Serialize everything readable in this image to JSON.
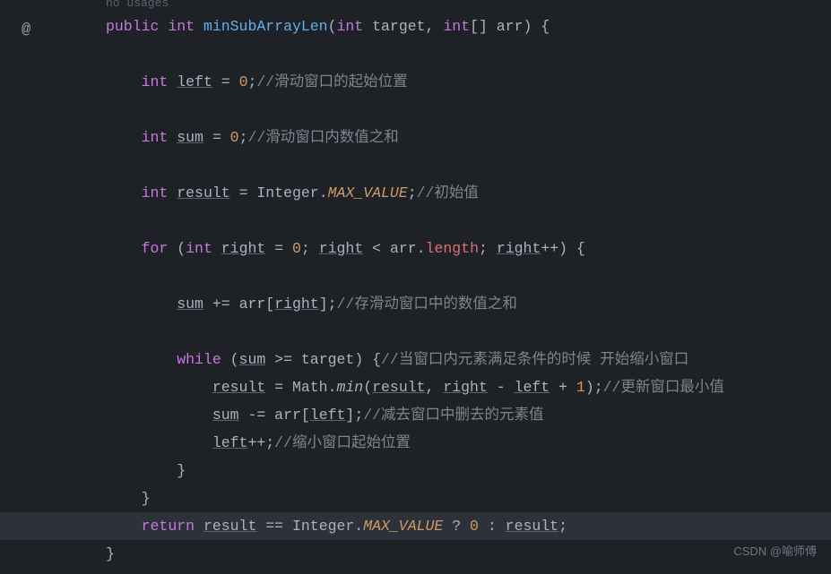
{
  "gutter": {
    "icon_glyph": "@"
  },
  "usages_hint": "no usages",
  "code": {
    "l1": {
      "public": "public",
      "int": "int",
      "method": "minSubArrayLen",
      "lparen": "(",
      "ptype1": "int",
      "pname1": "target",
      "comma": ",",
      "ptype2": "int",
      "brackets": "[]",
      "pname2": "arr",
      "rparen": ")",
      "brace": "{"
    },
    "l2": {
      "int": "int",
      "var": "left",
      "eq": "=",
      "num": "0",
      "semi": ";",
      "comment": "//滑动窗口的起始位置"
    },
    "l3": {
      "int": "int",
      "var": "sum",
      "eq": "=",
      "num": "0",
      "semi": ";",
      "comment": "//滑动窗口内数值之和"
    },
    "l4": {
      "int": "int",
      "var": "result",
      "eq": "=",
      "cls": "Integer",
      "dot": ".",
      "const": "MAX_VALUE",
      "semi": ";",
      "comment": "//初始值"
    },
    "l5": {
      "for": "for",
      "lparen": "(",
      "int": "int",
      "var": "right",
      "eq": "=",
      "num": "0",
      "semi1": ";",
      "var2": "right",
      "lt": "<",
      "arr": "arr",
      "dot": ".",
      "length": "length",
      "semi2": ";",
      "var3": "right",
      "inc": "++",
      "rparen": ")",
      "brace": "{"
    },
    "l6": {
      "var": "sum",
      "op": "+=",
      "arr": "arr",
      "lb": "[",
      "idx": "right",
      "rb": "]",
      "semi": ";",
      "comment": "//存滑动窗口中的数值之和"
    },
    "l7": {
      "while": "while",
      "lparen": "(",
      "var": "sum",
      "op": ">=",
      "target": "target",
      "rparen": ")",
      "brace": "{",
      "comment": "//当窗口内元素满足条件的时候 开始缩小窗口"
    },
    "l8": {
      "var": "result",
      "eq": "=",
      "cls": "Math",
      "dot": ".",
      "method": "min",
      "lparen": "(",
      "arg1": "result",
      "comma": ",",
      "arg2": "right",
      "minus": "-",
      "arg3": "left",
      "plus": "+",
      "num": "1",
      "rparen": ")",
      "semi": ";",
      "comment": "//更新窗口最小值"
    },
    "l9": {
      "var": "sum",
      "op": "-=",
      "arr": "arr",
      "lb": "[",
      "idx": "left",
      "rb": "]",
      "semi": ";",
      "comment": "//减去窗口中删去的元素值"
    },
    "l10": {
      "var": "left",
      "inc": "++",
      "semi": ";",
      "comment": "//缩小窗口起始位置"
    },
    "l11": {
      "brace": "}"
    },
    "l12": {
      "brace": "}"
    },
    "l13": {
      "return": "return",
      "var": "result",
      "eqeq": "==",
      "cls": "Integer",
      "dot": ".",
      "const": "MAX_VALUE",
      "q": "?",
      "num": "0",
      "colon": ":",
      "var2": "result",
      "semi": ";"
    },
    "l14": {
      "brace": "}"
    }
  },
  "watermark": "CSDN @喻师傅"
}
